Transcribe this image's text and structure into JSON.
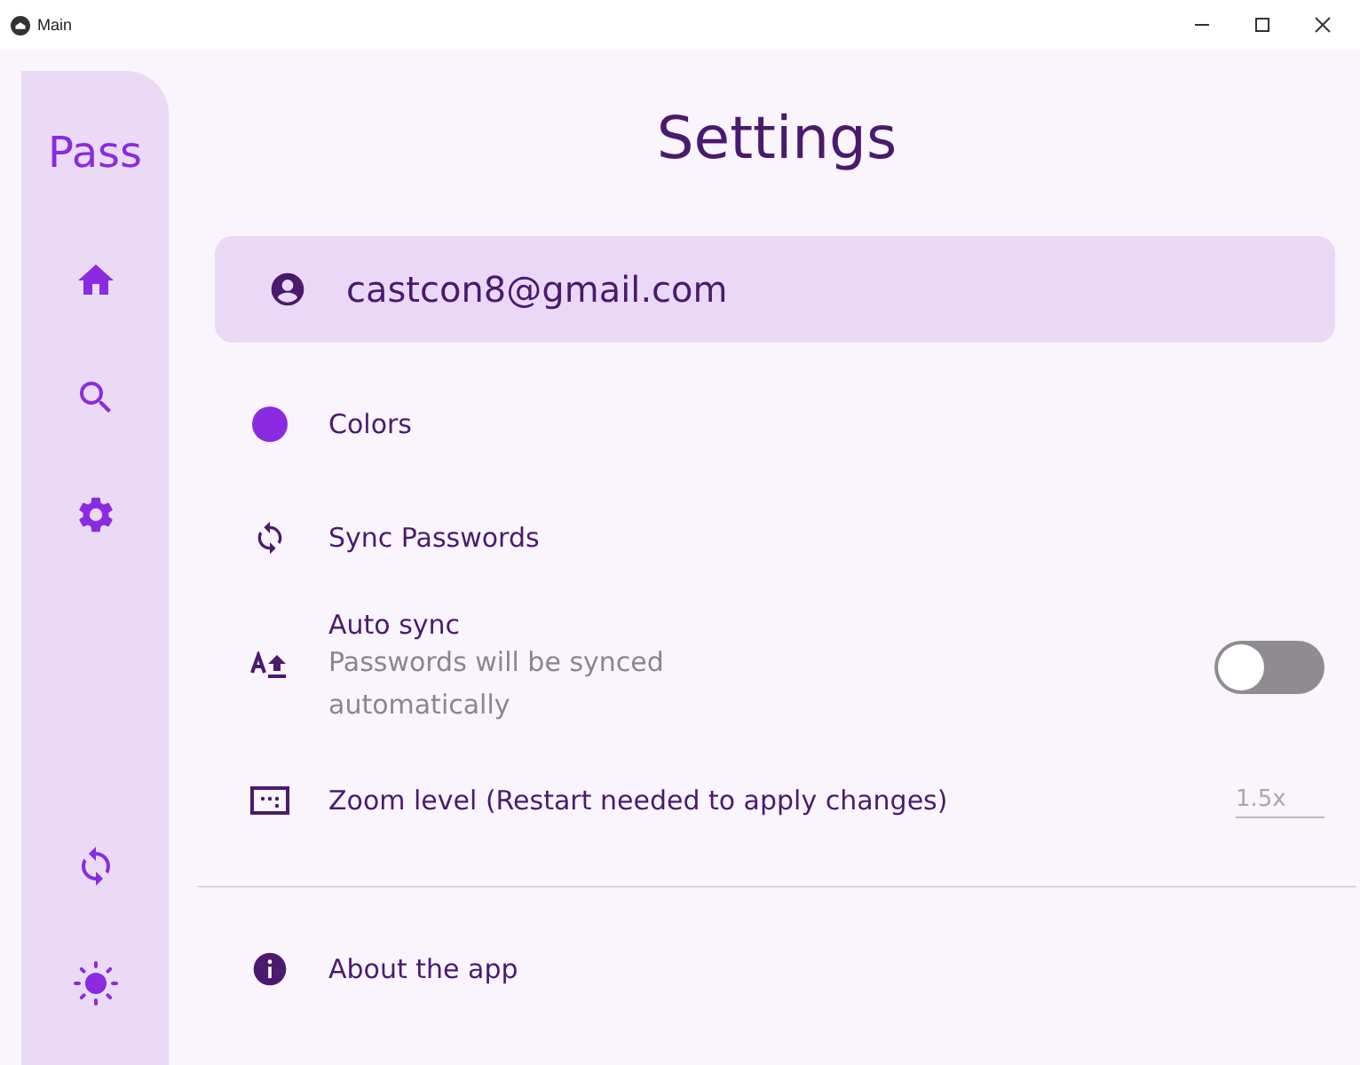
{
  "window": {
    "title": "Main"
  },
  "sidebar": {
    "app_name": "Pass"
  },
  "page_title": "Settings",
  "account": {
    "email": "castcon8@gmail.com"
  },
  "settings": [
    {
      "kind": "link",
      "label": "Colors"
    },
    {
      "kind": "link",
      "label": "Sync Passwords"
    },
    {
      "kind": "toggle",
      "label": "Auto sync",
      "description": "Passwords will be synced automatically",
      "on": false
    },
    {
      "kind": "field",
      "label": "Zoom level (Restart needed to apply changes)",
      "placeholder": "1.5x"
    }
  ],
  "about": {
    "label": "About the app"
  }
}
